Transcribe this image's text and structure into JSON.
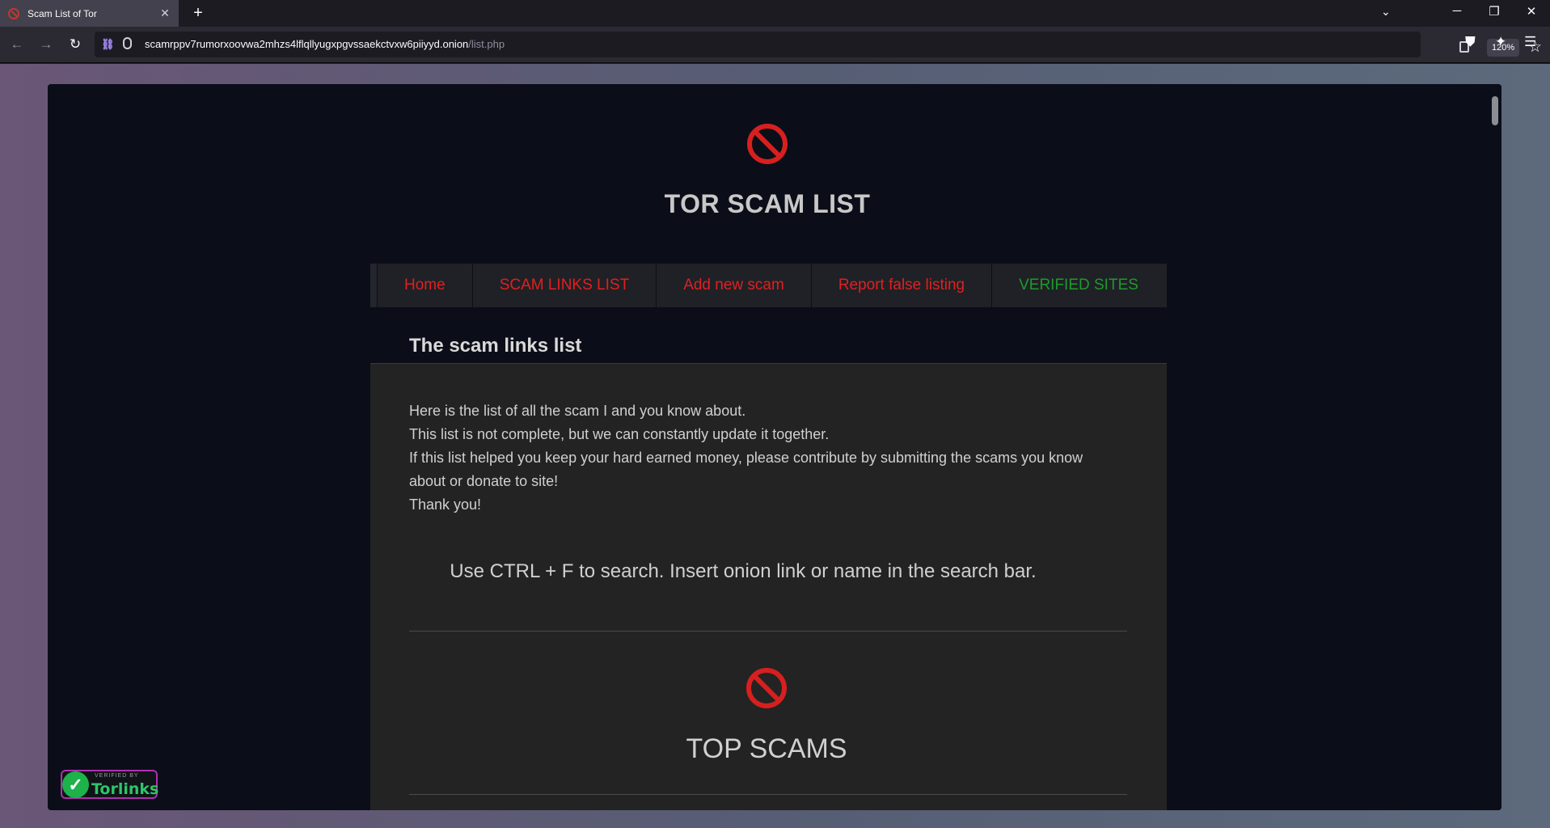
{
  "browser": {
    "tab": {
      "title": "Scam List of Tor",
      "close_glyph": "✕"
    },
    "new_tab_glyph": "+",
    "tab_list_glyph": "⌄",
    "window_controls": {
      "minimize": "─",
      "restore": "❐",
      "close": "✕"
    },
    "nav": {
      "back": "←",
      "forward": "→",
      "reload": "↻"
    },
    "url": {
      "host": "scamrppv7rumorxoovwa2mhzs4lflqllyugxpgvssaekctvxw6piiyyd.onion",
      "path": "/list.php"
    },
    "zoom": "120%",
    "icons": {
      "tracking_icon": "tracking-protection-icon",
      "lock_icon": "onion-lock-icon",
      "reader_icon": "reader-view-icon",
      "bookmark_icon": "star-icon",
      "shield_icon": "shield-icon",
      "extensions_icon": "extensions-icon",
      "menu_icon": "hamburger-menu-icon"
    },
    "toolbar_glyphs": {
      "star": "☆",
      "shield": "⛊",
      "extensions": "✦",
      "menu": "☰"
    }
  },
  "site": {
    "title": "TOR SCAM LIST",
    "logo_color": "#d6201f",
    "menu": [
      {
        "label": "Home",
        "color": "red"
      },
      {
        "label": "SCAM LINKS LIST",
        "color": "red"
      },
      {
        "label": "Add new scam",
        "color": "red"
      },
      {
        "label": "Report false listing",
        "color": "red"
      },
      {
        "label": "VERIFIED SITES",
        "color": "green"
      }
    ],
    "section_title": "The scam links list",
    "intro_lines": [
      "Here is the list of all the scam I and you know about.",
      "This list is not complete, but we can constantly update it together.",
      "If this list helped you keep your hard earned money, please contribute by submitting the scams you know about or donate to site!",
      "Thank you!"
    ],
    "search_hint": "Use CTRL + F to search. Insert onion link or name in the search bar.",
    "top_title": "TOP SCAMS",
    "badge": {
      "small_text": "VERIFIED BY",
      "name": "Torlinks",
      "check_glyph": "✓"
    }
  }
}
